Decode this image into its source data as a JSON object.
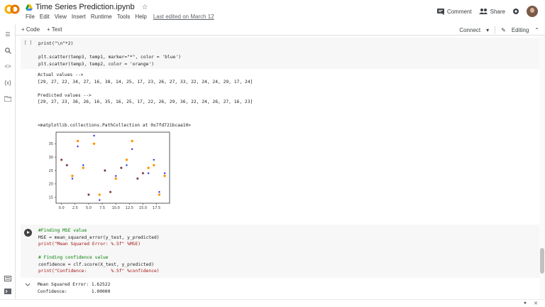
{
  "header": {
    "title": "Time Series Prediction.ipynb",
    "menu": [
      "File",
      "Edit",
      "View",
      "Insert",
      "Runtime",
      "Tools",
      "Help"
    ],
    "last_edited": "Last edited on March 12",
    "comment_label": "Comment",
    "share_label": "Share"
  },
  "toolbar": {
    "code_label": "+ Code",
    "text_label": "+ Text",
    "connect_label": "Connect",
    "editing_label": "Editing"
  },
  "cell1": {
    "bracket": "[ ]",
    "code_line1": "print(\"\\n\"*2)",
    "code_line3": "plt.scatter(temp3, temp1, marker=\"*\", color = 'blue')",
    "code_line4": "plt.scatter(temp3, temp2, color = 'orange')",
    "out_actual_label": "Actual values -->",
    "out_actual_values": "[29, 27, 22, 34, 27, 16, 38, 14, 25, 17, 23, 26, 27, 33, 22, 24, 24, 29, 17, 24]",
    "out_pred_label": "Predicted values -->",
    "out_pred_values": "[29, 27, 23, 36, 26, 16, 35, 16, 25, 17, 22, 26, 29, 36, 22, 24, 26, 27, 16, 23]",
    "out_collection": "<matplotlib.collections.PathCollection at 0x7fd721bcaa10>"
  },
  "cell2": {
    "line1": "#Finding MSE value",
    "line2": "MSE = mean_squared_error(y_test, y_predicted)",
    "line3": "print(\"Mean Squared Error: %.5f\" %MSE)",
    "line5": "# Finding confidence value",
    "line6": "confidence = clf.score(X_test, y_predicted)",
    "line7": "print(\"Confidence:         %.5f\" %confidence)",
    "out1": "Mean Squared Error: 1.62522",
    "out2": "Confidence:         1.00000"
  },
  "chart_data": {
    "type": "scatter",
    "x": [
      0,
      1,
      2,
      3,
      4,
      5,
      6,
      7,
      8,
      9,
      10,
      11,
      12,
      13,
      14,
      15,
      16,
      17,
      18,
      19
    ],
    "series": [
      {
        "values": [
          29,
          27,
          22,
          34,
          27,
          16,
          38,
          14,
          25,
          17,
          23,
          26,
          27,
          33,
          22,
          24,
          24,
          29,
          17,
          24
        ],
        "color": "#1f1fd6",
        "marker": "star"
      },
      {
        "values": [
          29,
          27,
          23,
          36,
          26,
          16,
          35,
          16,
          25,
          17,
          22,
          26,
          29,
          36,
          22,
          24,
          26,
          27,
          16,
          23
        ],
        "color": "#ff9900",
        "marker": "circle"
      }
    ],
    "xticks": [
      "0.0",
      "2.5",
      "5.0",
      "7.5",
      "10.0",
      "12.5",
      "15.0",
      "17.5"
    ],
    "yticks": [
      "15",
      "20",
      "25",
      "30",
      "35"
    ],
    "xlim": [
      -1,
      19.9
    ],
    "ylim": [
      12.8,
      39.3
    ]
  },
  "colors": {
    "logo_orange": "#f9ab00",
    "accent_blue": "#1a73e8"
  }
}
